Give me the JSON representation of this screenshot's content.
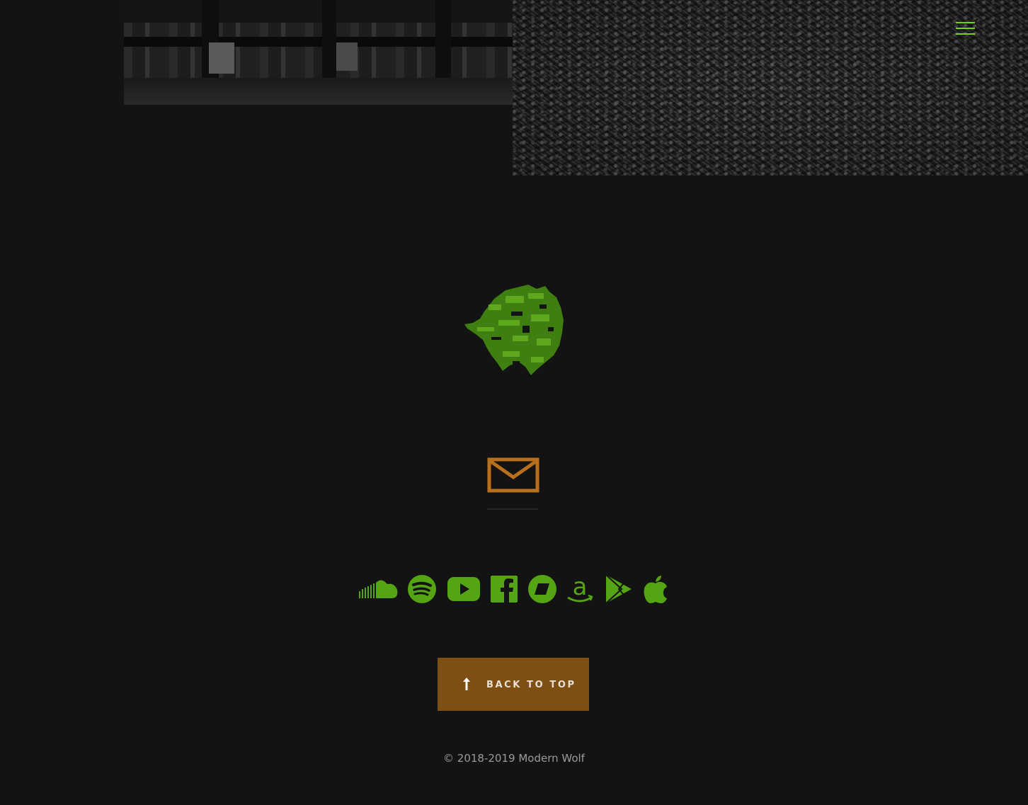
{
  "header": {
    "menu_icon": "hamburger-menu-icon",
    "menu_color": "#76d116"
  },
  "logo": {
    "icon": "wolf-head-logo",
    "color": "#4a8f17"
  },
  "contact": {
    "icon": "envelope-icon",
    "color": "#b8701c"
  },
  "social": {
    "color": "#55a414",
    "icons": [
      "soundcloud-icon",
      "spotify-icon",
      "youtube-icon",
      "facebook-icon",
      "bandcamp-icon",
      "amazon-icon",
      "google-play-icon",
      "apple-icon"
    ]
  },
  "back_to_top": {
    "label": "BACK TO TOP",
    "icon": "arrow-up-icon",
    "background": "#7e4f13"
  },
  "footer": {
    "copyright": "© 2018-2019 Modern Wolf"
  }
}
